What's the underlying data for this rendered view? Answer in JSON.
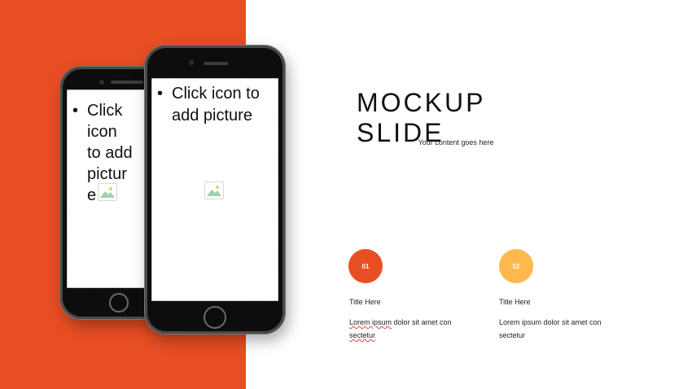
{
  "slide": {
    "title": "MOCKUP SLIDE",
    "subtitle": "Your content goes here",
    "colors": {
      "accent_orange": "#e84e23",
      "accent_yellow": "#fdb94d",
      "background": "#ffffff"
    }
  },
  "phones": {
    "back": {
      "placeholder_lines": [
        "Click",
        "icon",
        "to add",
        "pictur",
        "e"
      ],
      "icon": "picture-icon"
    },
    "front": {
      "placeholder_lines": [
        "Click icon to",
        "add picture"
      ],
      "icon": "picture-icon"
    }
  },
  "items": [
    {
      "number": "01",
      "title": "Title Here",
      "body_part1": "Lorem ipsum",
      "body_part2": " dolor sit amet con",
      "body_part3": "sectetur",
      "color": "#e84e23"
    },
    {
      "number": "02",
      "title": "Title Here",
      "body_part1": "Lorem ipsum dolor sit amet con",
      "body_part3": "sectetur",
      "color": "#fdb94d"
    }
  ]
}
